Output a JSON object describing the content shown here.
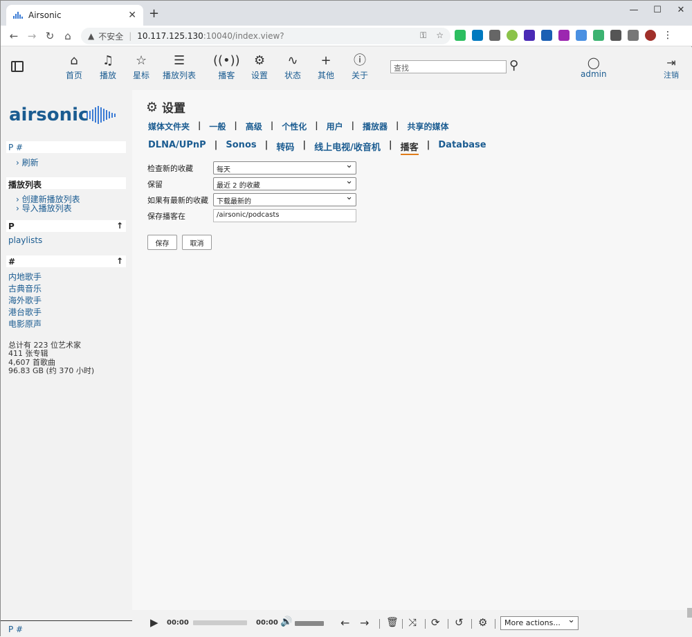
{
  "browser": {
    "tab_title": "Airsonic",
    "security_label": "不安全",
    "url_host": "10.117.125.130",
    "url_port_path": ":10040/index.view?"
  },
  "header": {
    "nav": [
      {
        "label": "首页",
        "icon": "home-icon"
      },
      {
        "label": "播放",
        "icon": "music-note-icon"
      },
      {
        "label": "星标",
        "icon": "star-icon"
      },
      {
        "label": "播放列表",
        "icon": "list-icon"
      },
      {
        "label": "播客",
        "icon": "podcast-icon"
      },
      {
        "label": "设置",
        "icon": "gear-icon"
      },
      {
        "label": "状态",
        "icon": "activity-icon"
      },
      {
        "label": "其他",
        "icon": "plus-icon"
      },
      {
        "label": "关于",
        "icon": "info-icon"
      }
    ],
    "search_placeholder": "查找",
    "user": "admin",
    "logout": "注销"
  },
  "sidebar": {
    "logo_text": "airsonic",
    "index_header": "P #",
    "refresh": "刷新",
    "playlists_header": "播放列表",
    "create_playlist": "创建新播放列表",
    "import_playlist": "导入播放列表",
    "p_header": "P",
    "p_items": [
      "playlists"
    ],
    "hash_header": "#",
    "hash_items": [
      "内地歌手",
      "古典音乐",
      "海外歌手",
      "港台歌手",
      "电影原声"
    ],
    "stats": [
      "总计有 223 位艺术家",
      "411 张专辑",
      "4,607 首歌曲",
      "96.83 GB (约 370 小时)"
    ],
    "footer": "P #"
  },
  "main": {
    "title": "设置",
    "tabs_row1": [
      "媒体文件夹",
      "一般",
      "高级",
      "个性化",
      "用户",
      "播放器",
      "共享的媒体"
    ],
    "tabs_row2": [
      "DLNA/UPnP",
      "Sonos",
      "转码",
      "线上电视/收音机",
      "播客",
      "Database"
    ],
    "active_tab": "播客",
    "fields": [
      {
        "label": "检查新的收藏",
        "value": "每天",
        "type": "select"
      },
      {
        "label": "保留",
        "value": "最近 2 的收藏",
        "type": "select"
      },
      {
        "label": "如果有最新的收藏",
        "value": "下载最新的",
        "type": "select"
      },
      {
        "label": "保存播客在",
        "value": "/airsonic/podcasts",
        "type": "text"
      }
    ],
    "save": "保存",
    "cancel": "取消"
  },
  "player": {
    "time_current": "00:00",
    "time_total": "00:00",
    "more_actions": "More actions..."
  },
  "colors": {
    "link": "#1b5c91",
    "accent": "#e07c1a"
  }
}
